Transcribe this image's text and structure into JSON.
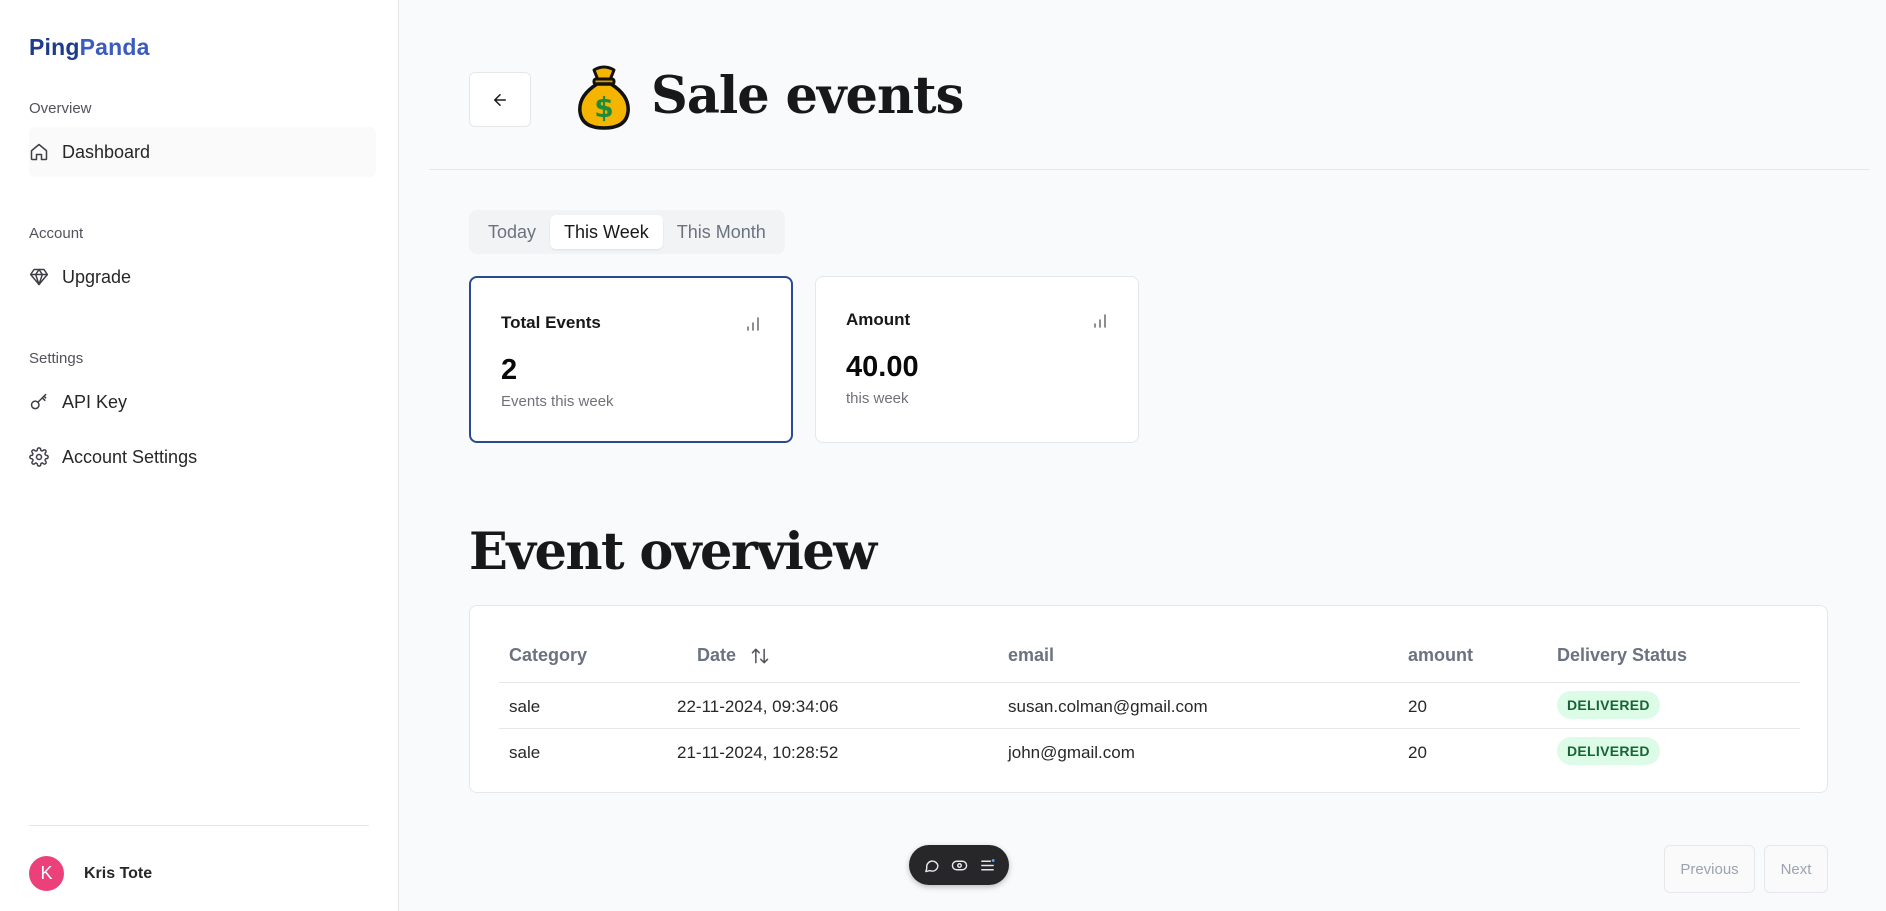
{
  "sidebar": {
    "brand_first": "Ping",
    "brand_second": "Panda",
    "sections": [
      {
        "label": "Overview"
      },
      {
        "label": "Account"
      },
      {
        "label": "Settings"
      }
    ],
    "items": [
      {
        "label": "Dashboard",
        "icon": "home-icon",
        "active": true
      },
      {
        "label": "Upgrade",
        "icon": "gem-icon"
      },
      {
        "label": "API Key",
        "icon": "key-icon"
      },
      {
        "label": "Account Settings",
        "icon": "gear-icon"
      }
    ],
    "user": {
      "initial": "K",
      "name": "Kris Tote",
      "avatar_color": "#ec407a"
    }
  },
  "header": {
    "title": "Sale events",
    "emoji": "money-bag",
    "back_icon": "arrow-left-icon"
  },
  "tabs": [
    {
      "label": "Today"
    },
    {
      "label": "This Week",
      "selected": true
    },
    {
      "label": "This Month"
    }
  ],
  "cards": [
    {
      "title": "Total Events",
      "value": "2",
      "sub": "Events this week",
      "icon": "bar-chart-icon",
      "selected": true
    },
    {
      "title": "Amount",
      "value": "40.00",
      "sub": "this week",
      "icon": "bar-chart-icon"
    }
  ],
  "overview": {
    "title": "Event overview",
    "columns": [
      "Category",
      "Date",
      "email",
      "amount",
      "Delivery Status"
    ],
    "rows": [
      {
        "category": "sale",
        "date": "22-11-2024, 09:34:06",
        "email": "susan.colman@gmail.com",
        "amount": "20",
        "status": "DELIVERED"
      },
      {
        "category": "sale",
        "date": "21-11-2024, 10:28:52",
        "email": "john@gmail.com",
        "amount": "20",
        "status": "DELIVERED"
      }
    ]
  },
  "pagination": {
    "previous": "Previous",
    "next": "Next"
  },
  "toolbar": {
    "icons": [
      "comment-icon",
      "eye-icon",
      "menu-icon"
    ]
  },
  "colors": {
    "brand": "#1e3a8a",
    "brand_accent": "#3b5bbd",
    "selected_border": "#2b4a94",
    "badge_bg": "#dcfce7",
    "badge_text": "#166534"
  }
}
